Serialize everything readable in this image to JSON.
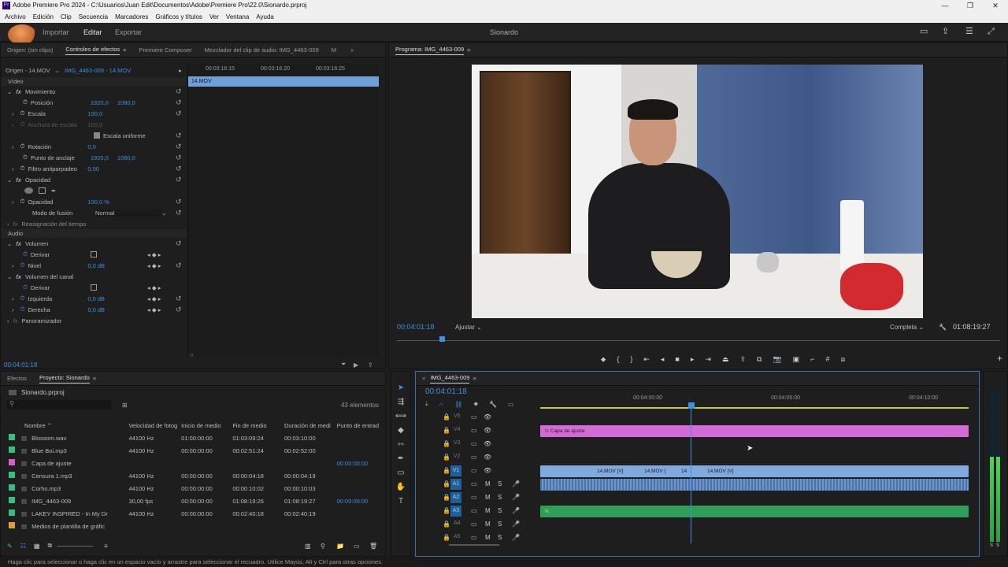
{
  "titlebar": {
    "title": "Adobe Premiere Pro 2024 - C:\\Usuarios\\Juan Edit\\Documentos\\Adobe\\Premiere Pro\\22.0\\Sionardo.prproj"
  },
  "menu": [
    "Archivo",
    "Edición",
    "Clip",
    "Secuencia",
    "Marcadores",
    "Gráficos y títulos",
    "Ver",
    "Ventana",
    "Ayuda"
  ],
  "workspace": {
    "tabs": [
      "Importar",
      "Editar",
      "Exportar"
    ],
    "active": "Editar",
    "project_name": "Sionardo"
  },
  "effect_controls": {
    "tabs": [
      "Origen: (sin clips)",
      "Controles de efectos",
      "Premiere Composer",
      "Mezclador del clip de audio: IMG_4463-009",
      "M"
    ],
    "source": "Origen - 14.MOV",
    "sequence_clip": "IMG_4463-009 - 14.MOV",
    "ruler": [
      "00:03:16:15",
      "00:03:16:20",
      "00:03:16:25"
    ],
    "clip_label": "14.MOV",
    "video_header": "Vídeo",
    "movimiento": "Movimiento",
    "posicion": {
      "label": "Posición",
      "x": "1920,0",
      "y": "1080,0"
    },
    "escala": {
      "label": "Escala",
      "value": "100,0"
    },
    "ancho": {
      "label": "Anchura de escala",
      "value": "100,0"
    },
    "uniforme": "Escala uniforme",
    "rotacion": {
      "label": "Rotación",
      "value": "0,0"
    },
    "anclaje": {
      "label": "Punto de anclaje",
      "x": "1920,0",
      "y": "1080,0"
    },
    "filtro": {
      "label": "Filtro antiparpadeo",
      "value": "0,00"
    },
    "opacidad_hdr": "Opacidad",
    "opacidad": {
      "label": "Opacidad",
      "value": "100,0 %"
    },
    "fusion": {
      "label": "Modo de fusión",
      "value": "Normal"
    },
    "reasignacion": "Reasignación del tiempo",
    "audio_header": "Audio",
    "volumen": "Volumen",
    "derivar": "Derivar",
    "nivel": {
      "label": "Nivel",
      "value": "0,0 dB"
    },
    "vol_canal": "Volumen del canal",
    "derivar2": "Derivar",
    "izquierda": {
      "label": "Izquierda",
      "value": "0,0 dB"
    },
    "derecha": {
      "label": "Derecha",
      "value": "0,0 dB"
    },
    "panoramizador": "Panoramizador",
    "timecode": "00:04:01:18"
  },
  "program": {
    "title": "Programa: IMG_4463-009",
    "timecode": "00:04:01:18",
    "fit": "Ajustar",
    "quality": "Completa",
    "duration": "01:08:19:27",
    "playhead": 0.07
  },
  "project": {
    "tabs": [
      "Efectos",
      "Proyecto: Sionardo"
    ],
    "file": "Sionardo.prproj",
    "count": "43 elementos",
    "columns": [
      "Nombre",
      "Velocidad de fotog",
      "Inicio de medio",
      "Fin de medio",
      "Duración de medi",
      "Punto de entrad"
    ],
    "rows": [
      {
        "color": "#2ec27e",
        "name": "Blossom.wav",
        "fps": "44100 Hz",
        "start": "01:00:00:00",
        "end": "01:03:09:24",
        "dur": "00:03:10:00",
        "in": ""
      },
      {
        "color": "#2ec27e",
        "name": "Blue Boi.mp3",
        "fps": "44100 Hz",
        "start": "00:00:00:00",
        "end": "00:02:51:24",
        "dur": "00:02:52:00",
        "in": ""
      },
      {
        "color": "#d35fd0",
        "name": "Capa de ajuste",
        "fps": "",
        "start": "",
        "end": "",
        "dur": "",
        "in": "00:00:00:00"
      },
      {
        "color": "#2ec27e",
        "name": "Censura 1.mp3",
        "fps": "44100 Hz",
        "start": "00:00:00:00",
        "end": "00:00:04:18",
        "dur": "00:00:04:19",
        "in": ""
      },
      {
        "color": "#2ec27e",
        "name": "Corho.mp3",
        "fps": "44100 Hz",
        "start": "00:00:00:00",
        "end": "00:00:10:02",
        "dur": "00:00:10:03",
        "in": ""
      },
      {
        "color": "#2ec27e",
        "name": "IMG_4463-009",
        "fps": "30,00 fps",
        "start": "00:00:00:00",
        "end": "01:08:19:26",
        "dur": "01:08:19:27",
        "in": "00:00:00:00"
      },
      {
        "color": "#2ec27e",
        "name": "LAKEY INSPIRED - In My Dr",
        "fps": "44100 Hz",
        "start": "00:00:00:00",
        "end": "00:02:40:18",
        "dur": "00:02:40:19",
        "in": ""
      },
      {
        "color": "#e0a030",
        "name": "Medios de plantilla de gráfic",
        "fps": "",
        "start": "",
        "end": "",
        "dur": "",
        "in": ""
      }
    ]
  },
  "timeline": {
    "tab": "IMG_4463-009",
    "timecode": "00:04:01:18",
    "ruler": [
      "00:04:00:00",
      "00:04:05:00",
      "00:04:10:00"
    ],
    "video_tracks": [
      "V5",
      "V4",
      "V3",
      "V2",
      "V1"
    ],
    "audio_tracks": [
      "A1",
      "A2",
      "A3",
      "A4",
      "A5"
    ],
    "adjust_clip": "Capa de ajuste",
    "v1_clips": [
      "14.MOV [V]",
      "14.MOV [",
      "14",
      "14.MOV [V]"
    ],
    "a3_clip": "fx"
  },
  "meters": {
    "labels": [
      "S",
      "S"
    ],
    "level_left": 0.55,
    "level_right": 0.55
  },
  "status": "Haga clic para seleccionar o haga clic en un espacio vacío y arrastre para seleccionar el recuadro. Utilice Mayús, Alt y Ctrl para otras opciones."
}
